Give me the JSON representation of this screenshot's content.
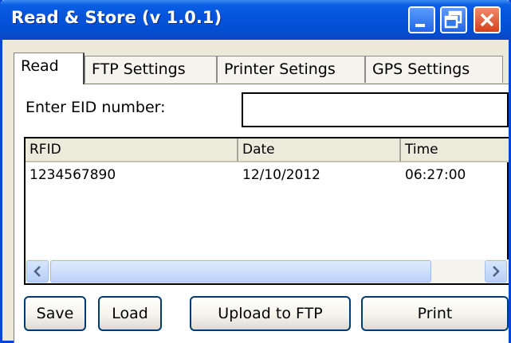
{
  "window": {
    "title": "Read & Store (v 1.0.1)",
    "accent_color": "#0a5fe4",
    "close_color": "#d6401c"
  },
  "tabs": [
    {
      "label": "Read",
      "active": true
    },
    {
      "label": "FTP Settings",
      "active": false
    },
    {
      "label": "Printer Setings",
      "active": false
    },
    {
      "label": "GPS Settings",
      "active": false
    }
  ],
  "eid": {
    "label": "Enter EID number:",
    "value": ""
  },
  "table": {
    "columns": [
      "RFID",
      "Date",
      "Time"
    ],
    "rows": [
      [
        "1234567890",
        "12/10/2012",
        "06:27:00"
      ]
    ]
  },
  "buttons": {
    "save": "Save",
    "load": "Load",
    "upload": "Upload to FTP",
    "print": "Print"
  }
}
